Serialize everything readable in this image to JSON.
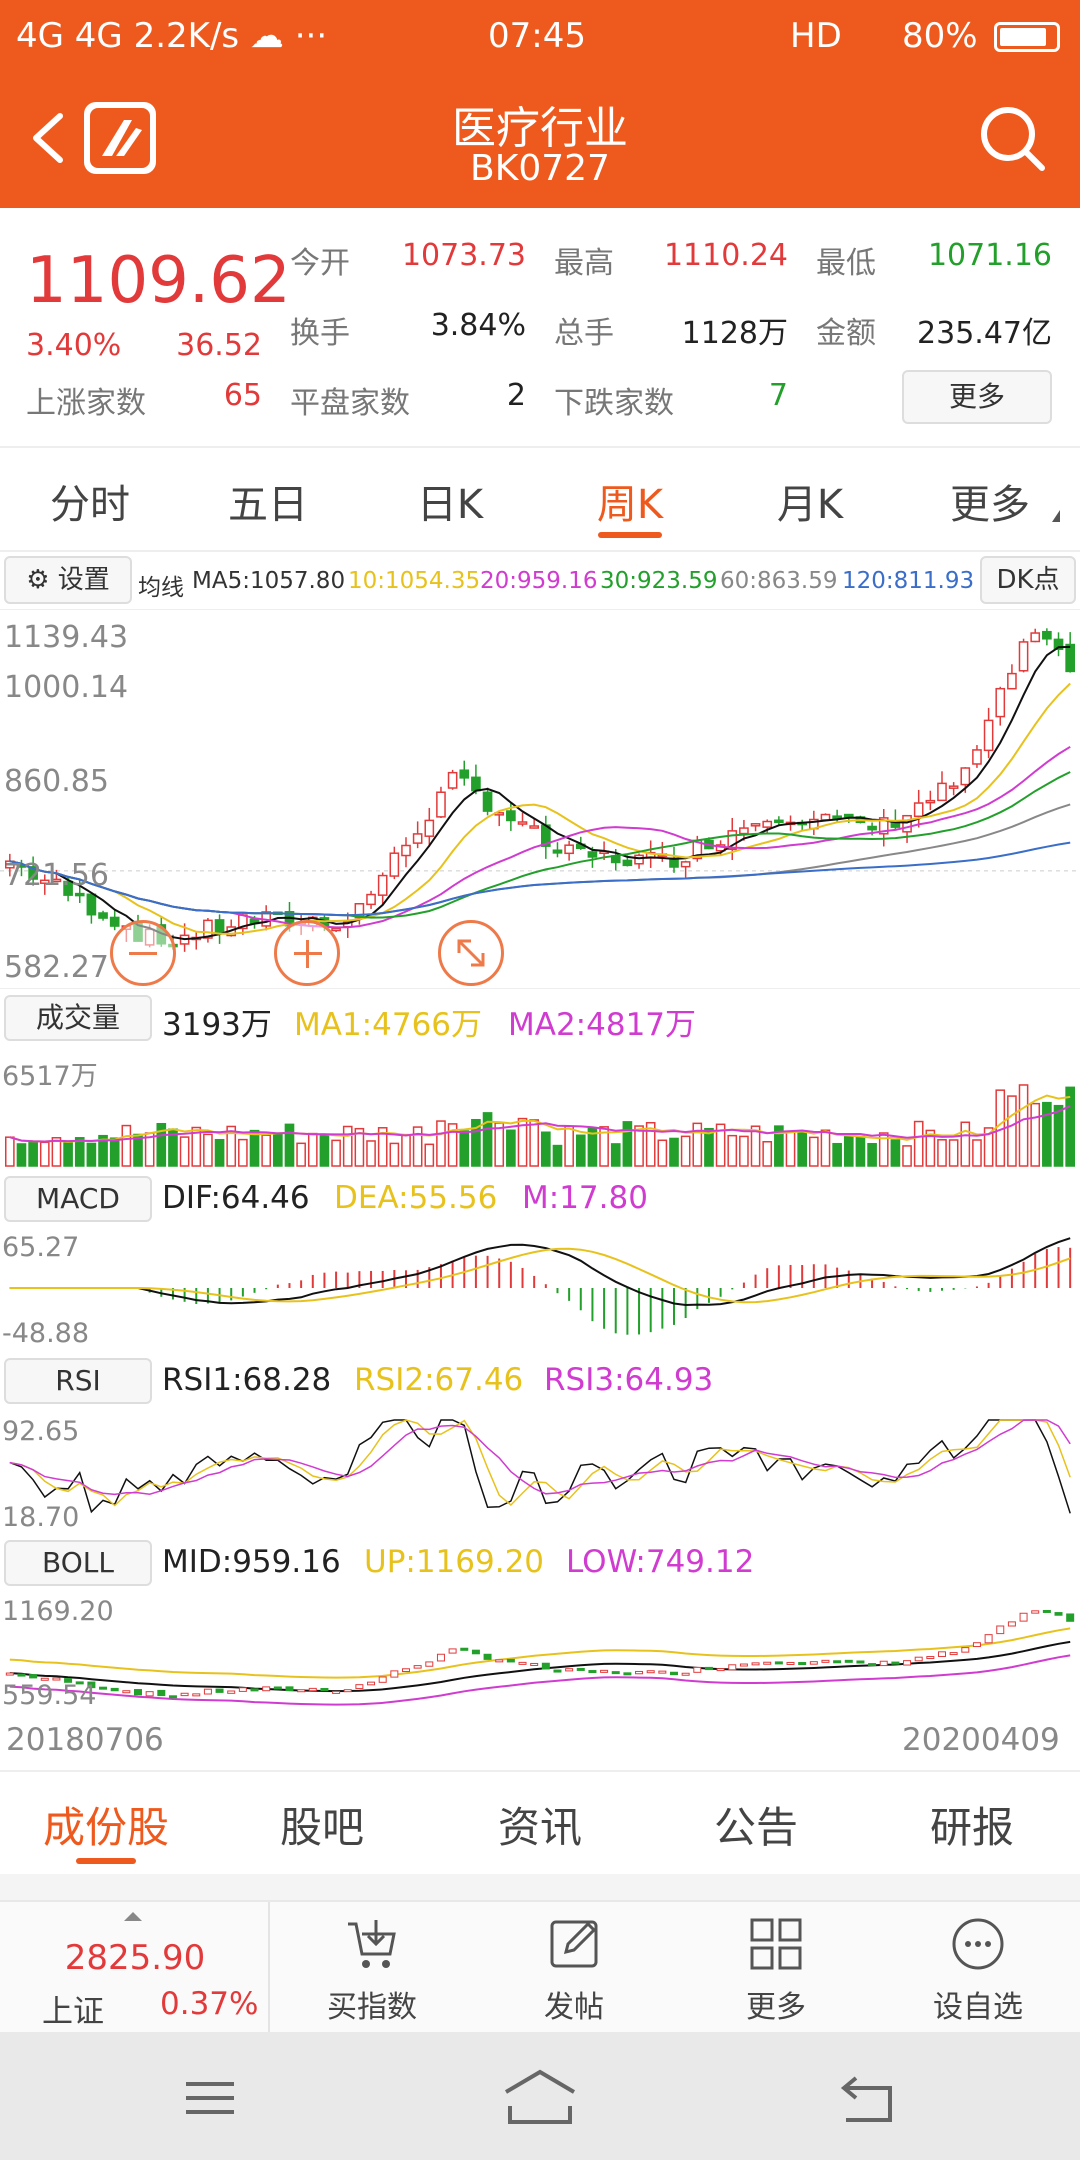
{
  "status_bar": {
    "left": "4G 4G 2.2K/s ☁ ···",
    "time": "07:45",
    "right": "HD",
    "battery": "80%"
  },
  "header": {
    "title": "医疗行业",
    "code": "BK0727"
  },
  "quote": {
    "price": "1109.62",
    "change_pct": "3.40%",
    "change": "36.52",
    "open_label": "今开",
    "open": "1073.73",
    "high_label": "最高",
    "high": "1110.24",
    "low_label": "最低",
    "low": "1071.16",
    "turnover_label": "换手",
    "turnover": "3.84%",
    "volume_label": "总手",
    "volume": "1128万",
    "amount_label": "金额",
    "amount": "235.47亿",
    "up_label": "上涨家数",
    "up": "65",
    "flat_label": "平盘家数",
    "flat": "2",
    "down_label": "下跌家数",
    "down": "7",
    "more_label": "更多"
  },
  "period_tabs": [
    "分时",
    "五日",
    "日K",
    "周K",
    "月K",
    "更多"
  ],
  "active_tab": "周K",
  "ma": {
    "settings_label": "设置",
    "prefix": "均线",
    "ma5": "MA5:1057.80",
    "ma10": "10:1054.35",
    "ma20": "20:959.16",
    "ma30": "30:923.59",
    "ma60": "60:863.59",
    "ma120": "120:811.93",
    "dk_label": "DK点"
  },
  "kline_axis": [
    "1139.43",
    "1000.14",
    "860.85",
    "721.56",
    "582.27"
  ],
  "volume_panel": {
    "label": "成交量",
    "value": "3193万",
    "ma1": "MA1:4766万",
    "ma2": "MA2:4817万",
    "axis_max": "6517万"
  },
  "macd_panel": {
    "label": "MACD",
    "dif": "DIF:64.46",
    "dea": "DEA:55.56",
    "m": "M:17.80",
    "axis_max": "65.27",
    "axis_min": "-48.88"
  },
  "rsi_panel": {
    "label": "RSI",
    "rsi1": "RSI1:68.28",
    "rsi2": "RSI2:67.46",
    "rsi3": "RSI3:64.93",
    "axis_max": "92.65",
    "axis_min": "18.70"
  },
  "boll_panel": {
    "label": "BOLL",
    "mid": "MID:959.16",
    "up": "UP:1169.20",
    "low": "LOW:749.12",
    "axis_max": "1169.20",
    "axis_min": "559.54"
  },
  "date_range": {
    "start": "20180706",
    "end": "20200409"
  },
  "sub_tabs": [
    "成份股",
    "股吧",
    "资讯",
    "公告",
    "研报"
  ],
  "active_sub_tab": "成份股",
  "index_ticker": {
    "value": "2825.90",
    "name": "上证",
    "pct": "0.37%"
  },
  "toolbar": [
    {
      "label": "买指数",
      "icon": "cart-icon"
    },
    {
      "label": "发帖",
      "icon": "edit-icon"
    },
    {
      "label": "更多",
      "icon": "grid-icon"
    },
    {
      "label": "设自选",
      "icon": "ellipsis-icon"
    }
  ],
  "colors": {
    "brand": "#ee5a1e",
    "up": "#e23a3a",
    "down": "#23a02b",
    "ma5": "#111111",
    "ma10": "#e8c21c",
    "ma20": "#d03cd0",
    "ma30": "#23a02b",
    "ma60": "#888888",
    "ma120": "#3a6ec8"
  }
}
